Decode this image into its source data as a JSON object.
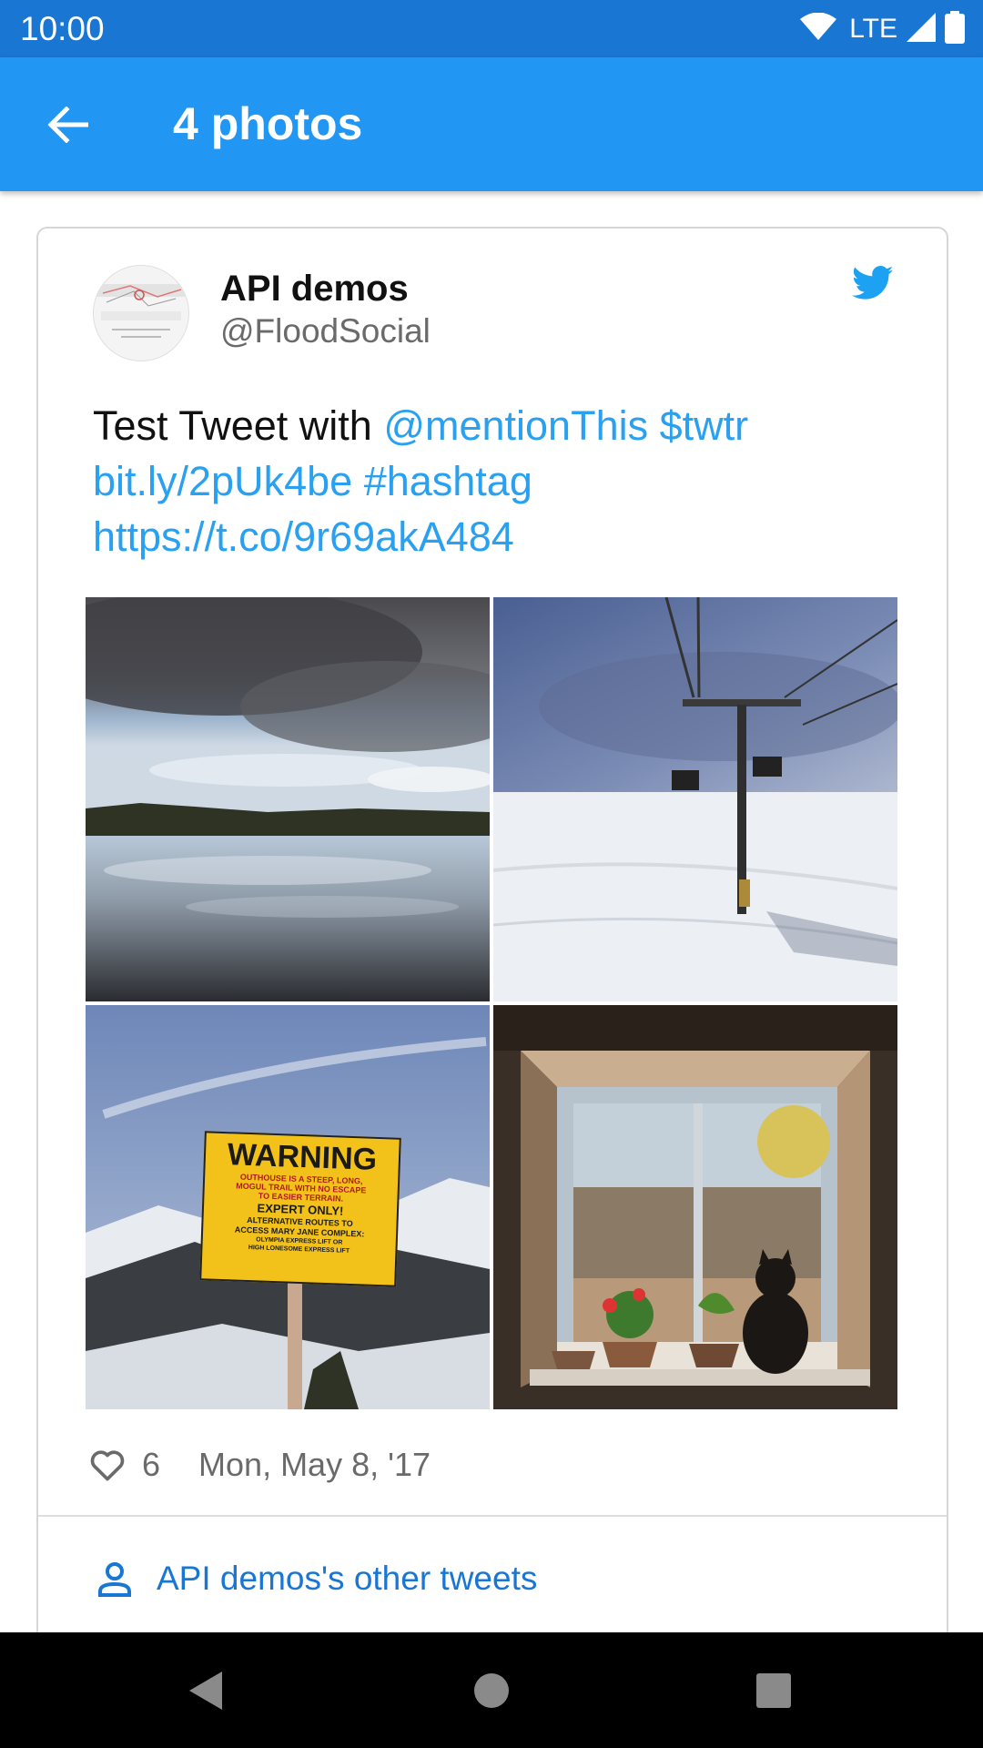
{
  "status_bar": {
    "time": "10:00",
    "network": "LTE",
    "icons": [
      "wifi-icon",
      "cell-signal-icon",
      "battery-icon"
    ]
  },
  "app_bar": {
    "title": "4 photos",
    "back_icon": "arrow-back-icon"
  },
  "tweet": {
    "author_name": "API demos",
    "author_handle": "@FloodSocial",
    "text_plain": "Test Tweet with ",
    "mention": "@mentionThis",
    "cashtag": "$twtr",
    "short_link": "bit.ly/2pUk4be",
    "hashtag": "#hashtag",
    "url": "https://t.co/9r69akA484",
    "photos": [
      {
        "name": "lake-reflection-photo"
      },
      {
        "name": "ski-lift-photo"
      },
      {
        "name": "warning-sign-photo",
        "sign_heading": "WARNING",
        "sign_lines": [
          "OUTHOUSE IS A STEEP, LONG,",
          "MOGUL TRAIL WITH NO ESCAPE",
          "TO EASIER TERRAIN.",
          "EXPERT ONLY!",
          "ALTERNATIVE ROUTES TO",
          "ACCESS MARY JANE COMPLEX:",
          "OLYMPIA EXPRESS LIFT OR",
          "HIGH LONESOME EXPRESS LIFT"
        ]
      },
      {
        "name": "cat-window-photo"
      }
    ],
    "likes": "6",
    "date": "Mon, May 8, '17",
    "other_tweets_label": "API demos's other tweets"
  },
  "colors": {
    "status_bar": "#1976d2",
    "app_bar": "#2196f3",
    "link": "#2aa0f0",
    "twitter_blue": "#1da1f2",
    "secondary_text": "#6a6a6a"
  }
}
